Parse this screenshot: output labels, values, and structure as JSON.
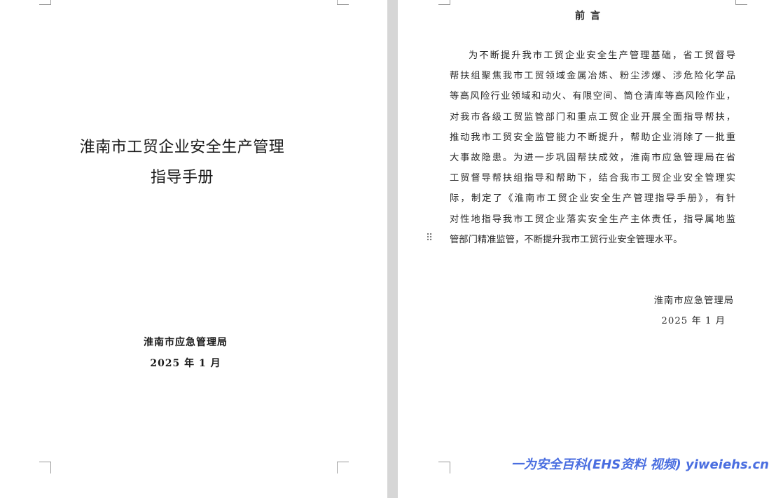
{
  "cover": {
    "title_line1": "淮南市工贸企业安全生产管理",
    "title_line2": "指导手册",
    "organization": "淮南市应急管理局",
    "date": "2025 年 1 月"
  },
  "preface": {
    "title": "前言",
    "lines": [
      "为不断提升我市工贸企业安全生产管理基础，省工贸督导",
      "帮扶组聚焦我市工贸领域金属冶炼、粉尘涉爆、涉危险化学品",
      "等高风险行业领域和动火、有限空间、筒仓清库等高风险作业，",
      "对我市各级工贸监管部门和重点工贸企业开展全面指导帮扶，",
      "推动我市工贸安全监管能力不断提升，帮助企业消除了一批重",
      "大事故隐患。为进一步巩固帮扶成效，淮南市应急管理局在省",
      "工贸督导帮扶组指导和帮助下，结合我市工贸企业安全管理实",
      "际，制定了《淮南市工贸企业安全生产管理指导手册》，有针",
      "对性地指导我市工贸企业落实安全生产主体责任，指导属地监",
      "管部门精准监管，不断提升我市工贸行业安全管理水平。"
    ],
    "signature_org": "淮南市应急管理局",
    "signature_date": "2025 年 1 月"
  },
  "icons": {
    "drag_handle": "drag-handle-icon"
  },
  "watermark": {
    "text": "一为安全百科(EHS资料 视频) yiweiehs.cn",
    "color": "#4a6ee0"
  }
}
